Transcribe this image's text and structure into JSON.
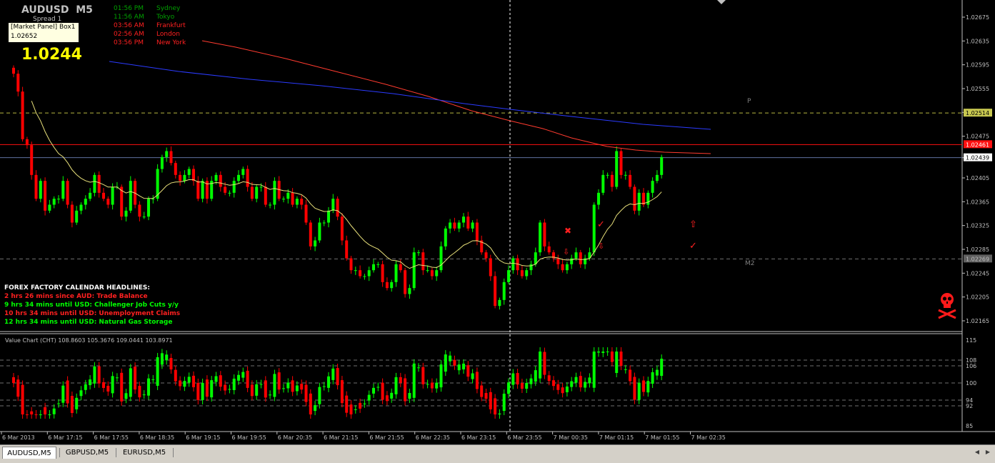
{
  "colors": {
    "bull": "#00ff00",
    "bear": "#ff0000",
    "ma_yellow": "#e8e07a",
    "ma_red": "#ff3b2f",
    "ma_blue": "#2b3bff",
    "axis": "#c0c0c0"
  },
  "header": {
    "symbol": "AUDUSD  M5",
    "spread_label": "Spread 1",
    "tooltip_title": "[Market Panel] Box1",
    "tooltip_value": "1.02652",
    "big_price": "1.0244"
  },
  "sessions": [
    {
      "time": "01:56 PM",
      "city": "Sydney",
      "color": "#00a000"
    },
    {
      "time": "11:56 AM",
      "city": "Tokyo",
      "color": "#00a000"
    },
    {
      "time": "03:56 AM",
      "city": "Frankfurt",
      "color": "#ff2020"
    },
    {
      "time": "02:56 AM",
      "city": "London",
      "color": "#ff2020"
    },
    {
      "time": "03:56 PM",
      "city": "New York",
      "color": "#ff2020"
    }
  ],
  "calendar": {
    "title": "FOREX FACTORY CALENDAR HEADLINES:",
    "items": [
      {
        "text": "2 hrs 26 mins since AUD: Trade Balance",
        "color": "#ff2020"
      },
      {
        "text": "9 hrs 34 mins until USD: Challenger Job Cuts y/y",
        "color": "#00ff00"
      },
      {
        "text": "10 hrs 34 mins until USD: Unemployment Claims",
        "color": "#ff2020"
      },
      {
        "text": "12 hrs 34 mins until USD: Natural Gas Storage",
        "color": "#00ff00"
      }
    ]
  },
  "line_labels": {
    "pivot": "P",
    "m2": "M2"
  },
  "skull_icon": "skull-crossbones-icon",
  "indicator_title": "Value Chart (CHT) 108.8603 105.3676 109.0441 103.8971",
  "tabs": [
    {
      "label": "AUDUSD,M5",
      "active": true
    },
    {
      "label": "GBPUSD,M5",
      "active": false
    },
    {
      "label": "EURUSD,M5",
      "active": false
    }
  ],
  "chart_data": {
    "type": "candlestick",
    "title": "AUDUSD  M5",
    "y_ticks": [
      1.02675,
      1.02635,
      1.02595,
      1.02555,
      1.02515,
      1.02475,
      1.02439,
      1.02405,
      1.02365,
      1.02325,
      1.02285,
      1.02245,
      1.02205,
      1.02165
    ],
    "ylim": [
      1.02159,
      1.027
    ],
    "levels": {
      "yellow": 1.02514,
      "red": 1.02461,
      "current": 1.02439,
      "m2": 1.02269
    },
    "level_labels": {
      "yellow": "1.02514",
      "red": "1.02461",
      "current": "1.02439",
      "m2": "1.02269"
    },
    "x_labels": [
      "6 Mar 2013",
      "6 Mar 17:15",
      "6 Mar 17:55",
      "6 Mar 18:35",
      "6 Mar 19:15",
      "6 Mar 19:55",
      "6 Mar 20:35",
      "6 Mar 21:15",
      "6 Mar 21:55",
      "6 Mar 22:35",
      "6 Mar 23:15",
      "6 Mar 23:55",
      "7 Mar 00:35",
      "7 Mar 01:15",
      "7 Mar 01:55",
      "7 Mar 02:35"
    ],
    "closes": [
      1.0258,
      1.0255,
      1.0247,
      1.0246,
      1.0241,
      1.0237,
      1.024,
      1.0235,
      1.0236,
      1.0237,
      1.0237,
      1.024,
      1.0236,
      1.0233,
      1.0235,
      1.0236,
      1.0237,
      1.0238,
      1.0241,
      1.0238,
      1.0237,
      1.0236,
      1.0239,
      1.0239,
      1.0234,
      1.0235,
      1.024,
      1.0236,
      1.0234,
      1.0234,
      1.0237,
      1.0237,
      1.0242,
      1.0244,
      1.0245,
      1.0243,
      1.0241,
      1.024,
      1.0241,
      1.0242,
      1.024,
      1.0237,
      1.024,
      1.0237,
      1.024,
      1.0241,
      1.0239,
      1.0238,
      1.0238,
      1.024,
      1.0241,
      1.0242,
      1.0239,
      1.0237,
      1.0239,
      1.0239,
      1.0236,
      1.0236,
      1.024,
      1.0237,
      1.0237,
      1.0238,
      1.0236,
      1.0237,
      1.0236,
      1.0233,
      1.0229,
      1.023,
      1.0233,
      1.0233,
      1.0235,
      1.0237,
      1.0234,
      1.023,
      1.0227,
      1.0225,
      1.0225,
      1.0224,
      1.0224,
      1.0225,
      1.0226,
      1.0226,
      1.0223,
      1.0222,
      1.0223,
      1.0226,
      1.0225,
      1.0221,
      1.0222,
      1.0228,
      1.0228,
      1.0225,
      1.0225,
      1.0224,
      1.0225,
      1.0229,
      1.0232,
      1.0233,
      1.0232,
      1.0233,
      1.0234,
      1.0232,
      1.0233,
      1.023,
      1.0228,
      1.0227,
      1.0224,
      1.0219,
      1.022,
      1.0223,
      1.0225,
      1.0227,
      1.0225,
      1.0224,
      1.0225,
      1.0226,
      1.0228,
      1.0233,
      1.0229,
      1.0228,
      1.0227,
      1.0226,
      1.0225,
      1.0226,
      1.0227,
      1.0228,
      1.0226,
      1.0227,
      1.0228,
      1.0236,
      1.0238,
      1.0241,
      1.0241,
      1.0239,
      1.0245,
      1.0241,
      1.0241,
      1.0239,
      1.0235,
      1.0238,
      1.0236,
      1.0238,
      1.024,
      1.0241,
      1.0244
    ]
  }
}
